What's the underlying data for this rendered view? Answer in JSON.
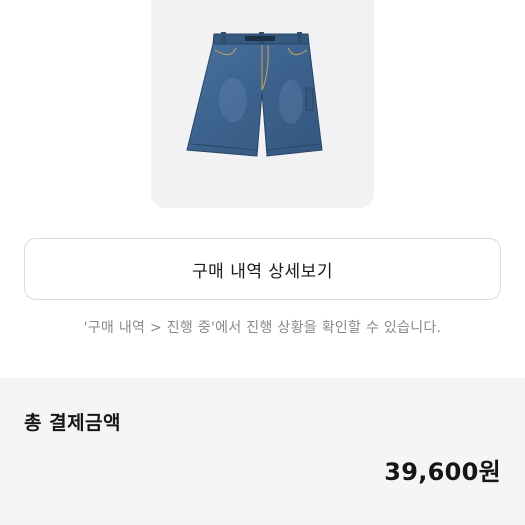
{
  "product": {
    "image_icon": "denim-shorts-image",
    "denim_color": "#3f6590"
  },
  "detail_button": {
    "label": "구매 내역 상세보기"
  },
  "hint": {
    "text": "'구매 내역 > 진행 중'에서 진행 상황을 확인할 수 있습니다."
  },
  "summary": {
    "label": "총 결제금액",
    "amount": "39,600원"
  }
}
